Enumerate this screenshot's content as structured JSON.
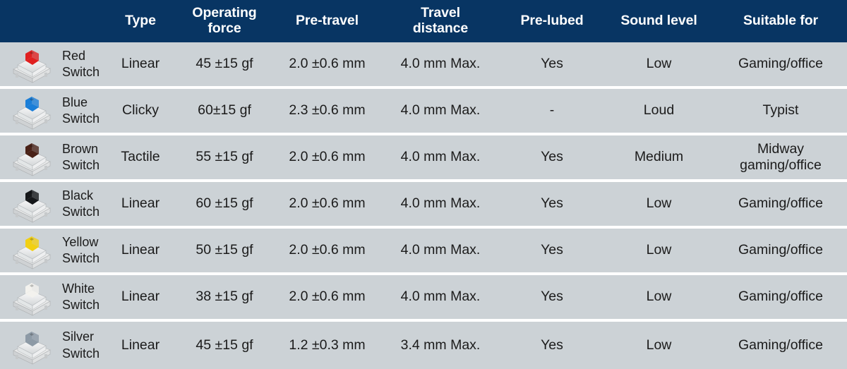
{
  "table": {
    "headers": [
      {
        "label": "",
        "name": "header-switch-image"
      },
      {
        "label": "",
        "name": "header-switch-name"
      },
      {
        "label": "Type",
        "name": "header-type"
      },
      {
        "label": "Operating force",
        "name": "header-operating-force"
      },
      {
        "label": "Pre-travel",
        "name": "header-pre-travel"
      },
      {
        "label": "Travel distance",
        "name": "header-travel-distance"
      },
      {
        "label": "Pre-lubed",
        "name": "header-pre-lubed"
      },
      {
        "label": "Sound level",
        "name": "header-sound-level"
      },
      {
        "label": "Suitable for",
        "name": "header-suitable-for"
      }
    ],
    "header_line1": {
      "type": "Type",
      "operating_force": "Operating",
      "pre_travel": "Pre-travel",
      "travel_distance": "Travel",
      "pre_lubed": "Pre-lubed",
      "sound_level": "Sound level",
      "suitable_for": "Suitable for"
    },
    "header_line2": {
      "operating_force": "force",
      "travel_distance": "distance"
    },
    "rows": [
      {
        "name_line1": "Red",
        "name_line2": "Switch",
        "stem_color": "#e02020",
        "type": "Linear",
        "operating_force": "45 ±15 gf",
        "pre_travel": "2.0 ±0.6 mm",
        "travel_distance": "4.0 mm Max.",
        "pre_lubed": "Yes",
        "sound_level": "Low",
        "suitable_for_line1": "Gaming/office",
        "suitable_for_line2": ""
      },
      {
        "name_line1": "Blue",
        "name_line2": "Switch",
        "stem_color": "#1a7ed8",
        "type": "Clicky",
        "operating_force": "60±15 gf",
        "pre_travel": "2.3 ±0.6 mm",
        "travel_distance": "4.0 mm Max.",
        "pre_lubed": "-",
        "sound_level": "Loud",
        "suitable_for_line1": "Typist",
        "suitable_for_line2": ""
      },
      {
        "name_line1": "Brown",
        "name_line2": "Switch",
        "stem_color": "#4a2218",
        "type": "Tactile",
        "operating_force": "55 ±15 gf",
        "pre_travel": "2.0 ±0.6 mm",
        "travel_distance": "4.0 mm Max.",
        "pre_lubed": "Yes",
        "sound_level": "Medium",
        "suitable_for_line1": "Midway",
        "suitable_for_line2": "gaming/office"
      },
      {
        "name_line1": "Black",
        "name_line2": "Switch",
        "stem_color": "#15171a",
        "type": "Linear",
        "operating_force": "60 ±15 gf",
        "pre_travel": "2.0 ±0.6 mm",
        "travel_distance": "4.0 mm Max.",
        "pre_lubed": "Yes",
        "sound_level": "Low",
        "suitable_for_line1": "Gaming/office",
        "suitable_for_line2": ""
      },
      {
        "name_line1": "Yellow",
        "name_line2": "Switch",
        "stem_color": "#f2d013",
        "type": "Linear",
        "operating_force": "50 ±15 gf",
        "pre_travel": "2.0 ±0.6 mm",
        "travel_distance": "4.0 mm Max.",
        "pre_lubed": "Yes",
        "sound_level": "Low",
        "suitable_for_line1": "Gaming/office",
        "suitable_for_line2": ""
      },
      {
        "name_line1": "White",
        "name_line2": "Switch",
        "stem_color": "#f3f2ee",
        "type": "Linear",
        "operating_force": "38 ±15 gf",
        "pre_travel": "2.0 ±0.6 mm",
        "travel_distance": "4.0 mm Max.",
        "pre_lubed": "Yes",
        "sound_level": "Low",
        "suitable_for_line1": "Gaming/office",
        "suitable_for_line2": ""
      },
      {
        "name_line1": "Silver",
        "name_line2": "Switch",
        "stem_color": "#8d9aa6",
        "type": "Linear",
        "operating_force": "45 ±15 gf",
        "pre_travel": "1.2 ±0.3 mm",
        "travel_distance": "3.4 mm Max.",
        "pre_lubed": "Yes",
        "sound_level": "Low",
        "suitable_for_line1": "Gaming/office",
        "suitable_for_line2": ""
      }
    ]
  },
  "colors": {
    "header_background": "#083563",
    "header_text": "#ffffff",
    "row_background": "#ccd2d6",
    "row_separator": "#ffffff",
    "body_text": "#1b1b1b"
  }
}
